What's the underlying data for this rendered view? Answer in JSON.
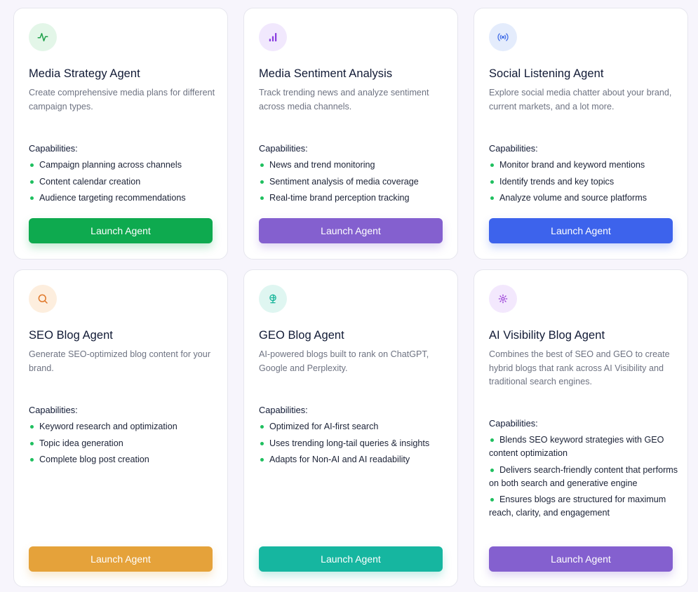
{
  "capabilities_label": "Capabilities:",
  "cards": [
    {
      "title": "Media Strategy Agent",
      "description": "Create comprehensive media plans for different campaign types.",
      "icon": "activity-pulse-icon",
      "icon_color": "#1fa04a",
      "icon_bg": "#e3f6e8",
      "capabilities": [
        "Campaign planning across channels",
        "Content calendar creation",
        "Audience targeting recommendations"
      ],
      "button_label": "Launch Agent",
      "button_color": "#0eaa4f"
    },
    {
      "title": "Media Sentiment Analysis",
      "description": "Track trending news and analyze sentiment across media channels.",
      "icon": "bar-chart-icon",
      "icon_color": "#8a3ee0",
      "icon_bg": "#f1e8fd",
      "capabilities": [
        "News and trend monitoring",
        "Sentiment analysis of media coverage",
        "Real-time brand perception tracking"
      ],
      "button_label": "Launch Agent",
      "button_color": "#8460cf"
    },
    {
      "title": "Social Listening Agent",
      "description": "Explore social media chatter about your brand, current markets, and a lot more.",
      "icon": "broadcast-icon",
      "icon_color": "#4a74e8",
      "icon_bg": "#e4ecfc",
      "capabilities": [
        "Monitor brand and keyword mentions",
        "Identify trends and key topics",
        "Analyze volume and source platforms"
      ],
      "button_label": "Launch Agent",
      "button_color": "#3d63ec"
    },
    {
      "title": "SEO Blog Agent",
      "description": "Generate SEO-optimized blog content for your brand.",
      "icon": "search-icon",
      "icon_color": "#e0782a",
      "icon_bg": "#fdeede",
      "capabilities": [
        "Keyword research and optimization",
        "Topic idea generation",
        "Complete blog post creation"
      ],
      "button_label": "Launch Agent",
      "button_color": "#e5a23a"
    },
    {
      "title": "GEO Blog Agent",
      "description": "AI-powered blogs built to rank on ChatGPT, Google and Perplexity.",
      "icon": "globe-icon",
      "icon_color": "#18b59a",
      "icon_bg": "#dff6f1",
      "capabilities": [
        "Optimized for AI-first search",
        "Uses trending long-tail queries & insights",
        "Adapts for Non-AI and AI readability"
      ],
      "button_label": "Launch Agent",
      "button_color": "#16b6a0"
    },
    {
      "title": "AI Visibility Blog Agent",
      "description": "Combines the best of SEO and GEO to create hybrid blogs that rank across AI Visibility and traditional search engines.",
      "icon": "gear-sparkle-icon",
      "icon_color": "#9a3ed8",
      "icon_bg": "#f3e8fd",
      "capabilities": [
        "Blends SEO keyword strategies with GEO content optimization",
        "Delivers search-friendly content that performs on both search and generative engine",
        "Ensures blogs are structured for maximum reach, clarity, and engagement"
      ],
      "button_label": "Launch Agent",
      "button_color": "#8460cf"
    }
  ]
}
